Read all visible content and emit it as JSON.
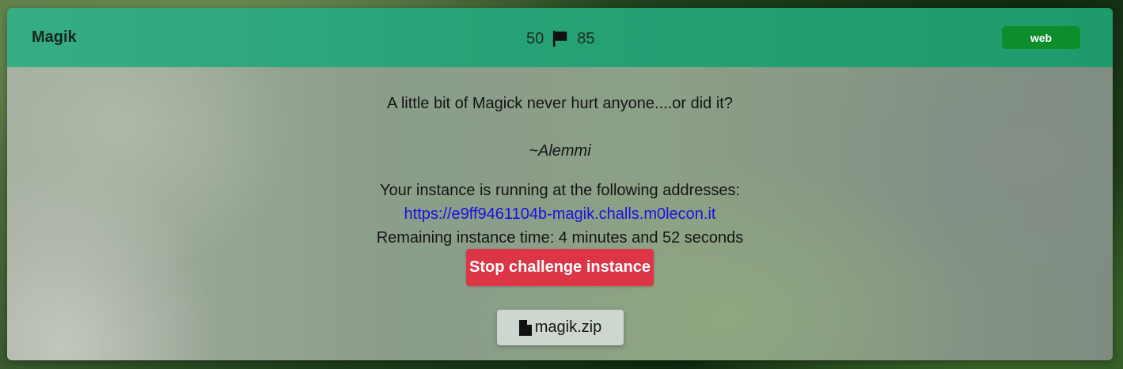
{
  "challenge": {
    "title": "Magik",
    "points": "50",
    "solves": "85",
    "category": "web",
    "description": "A little bit of Magick never hurt anyone....or did it?",
    "author": "~Alemmi"
  },
  "instance": {
    "running_text": "Your instance is running at the following addresses:",
    "url": "https://e9ff9461104b-magik.challs.m0lecon.it",
    "remaining_text": "Remaining instance time: 4 minutes and 52 seconds",
    "stop_label": "Stop challenge instance"
  },
  "attachment": {
    "filename": "magik.zip"
  },
  "icons": {
    "score": "flag-icon",
    "attachment": "file-icon"
  },
  "colors": {
    "header": "#27a377",
    "category_badge": "#0d8e2c",
    "stop_button": "#dc3546",
    "link": "#1a10e0"
  }
}
